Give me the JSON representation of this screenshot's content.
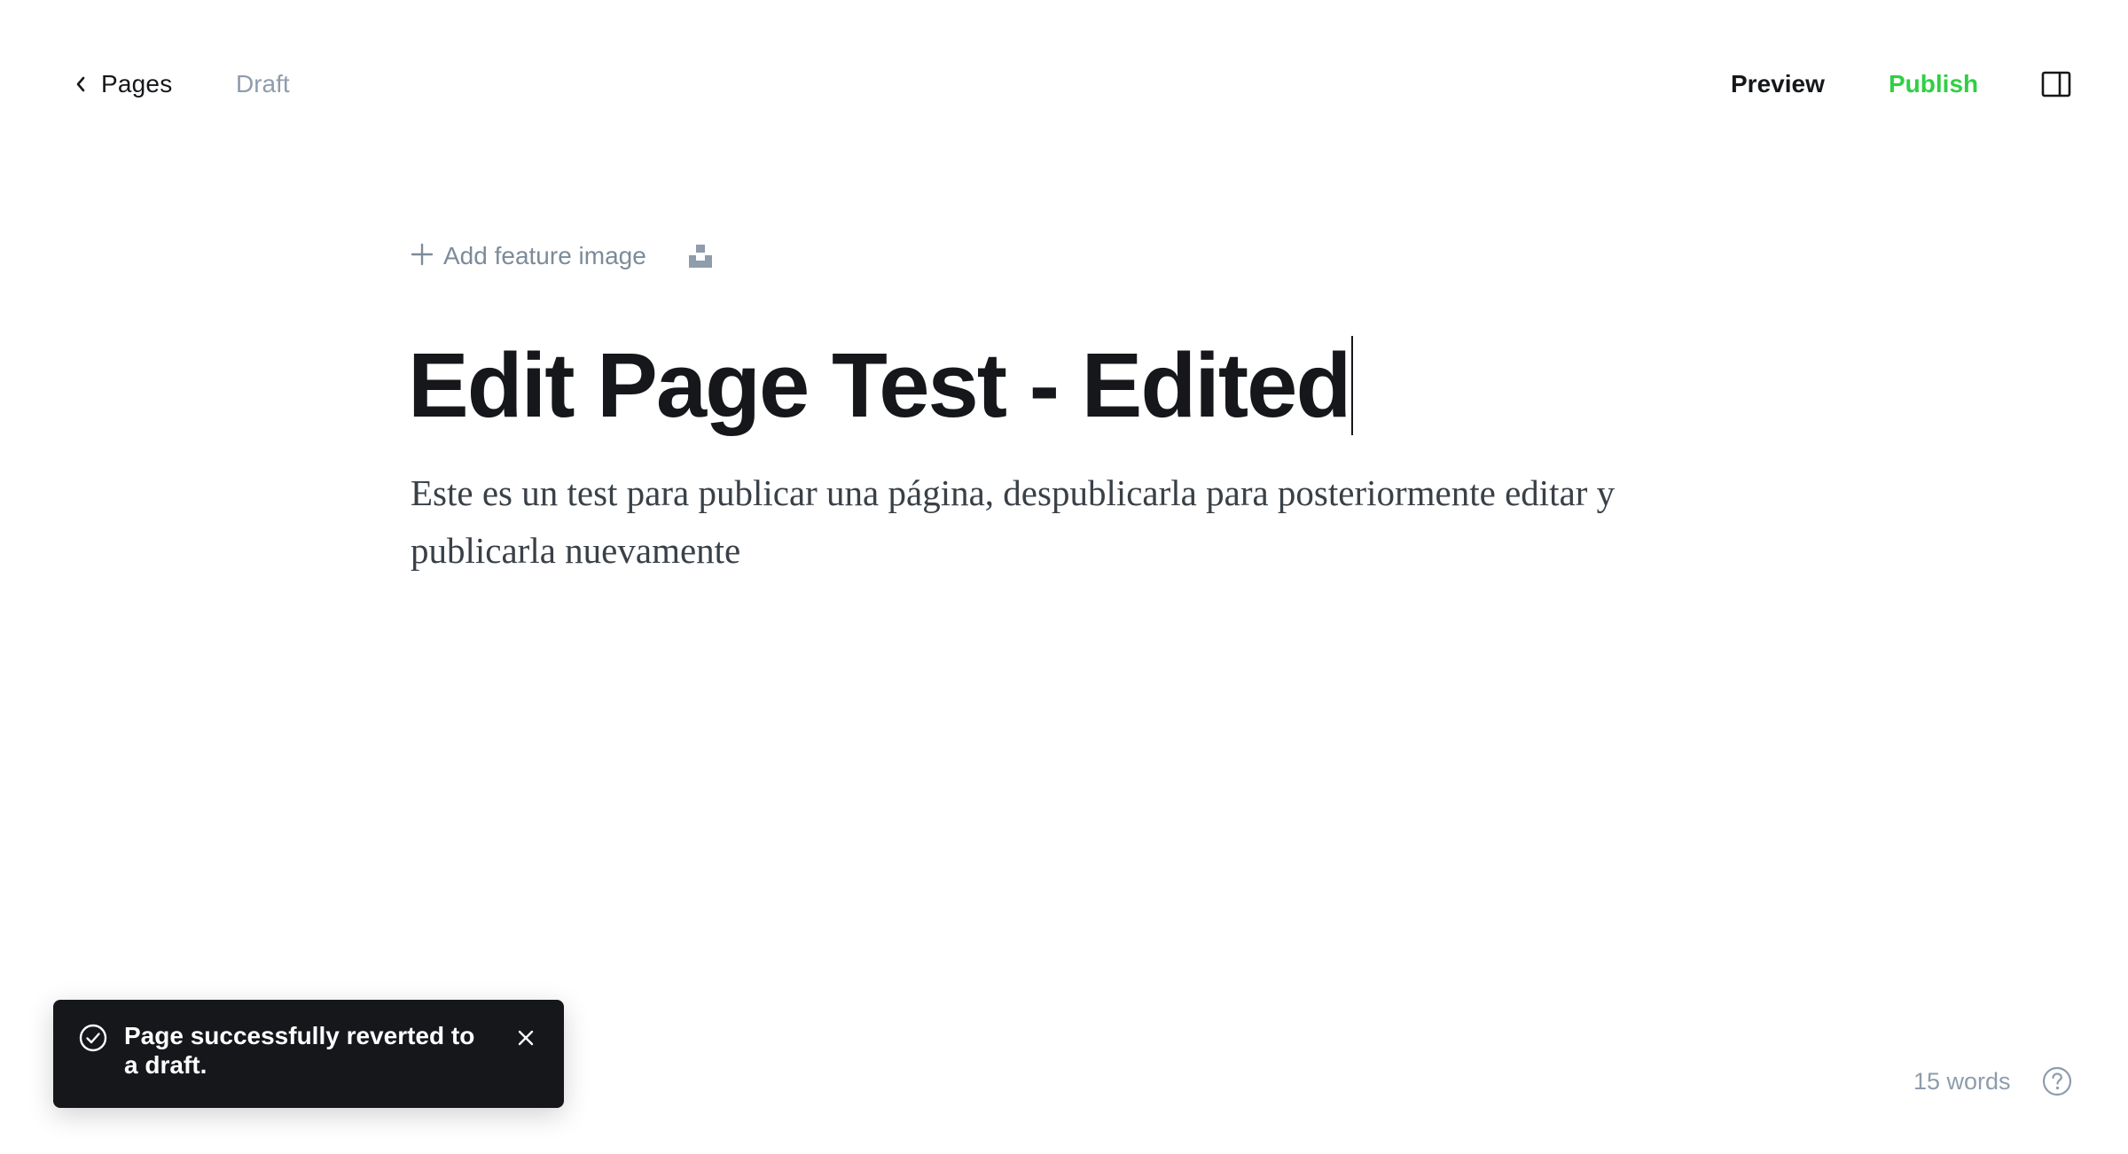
{
  "header": {
    "back_label": "Pages",
    "status": "Draft",
    "preview_label": "Preview",
    "publish_label": "Publish",
    "publish_color": "#30cf43"
  },
  "editor": {
    "add_feature_label": "Add feature image",
    "title": "Edit Page Test - Edited",
    "body": "Este es un test para publicar una página, despublicarla para posteriormente editar y publicarla nuevamente"
  },
  "toast": {
    "message": "Page successfully reverted to a draft.",
    "icon": "check-circle-icon"
  },
  "footer": {
    "word_count": "15 words",
    "help_icon": "question-circle-icon"
  }
}
